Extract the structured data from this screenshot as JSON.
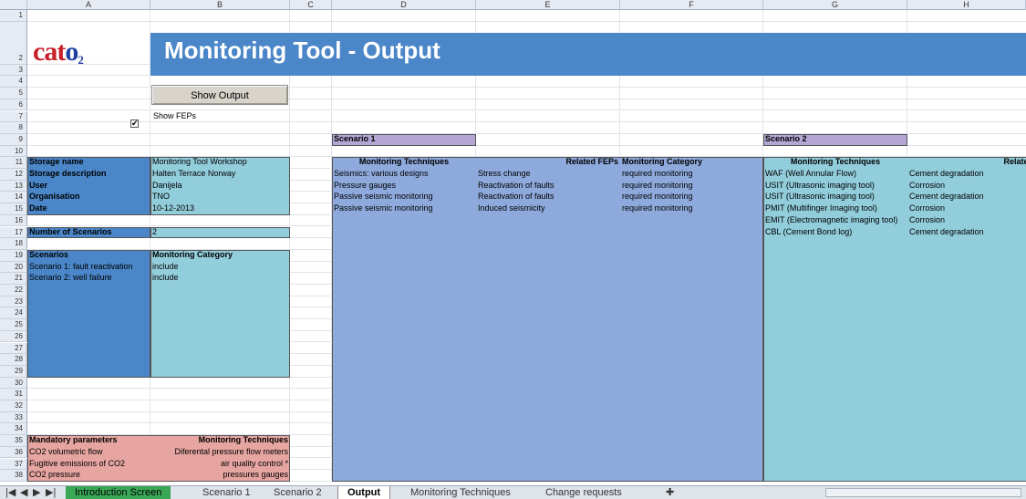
{
  "columns": [
    "A",
    "B",
    "C",
    "D",
    "E",
    "F",
    "G",
    "H"
  ],
  "title": "Monitoring Tool - Output",
  "logo": {
    "main": "cat",
    "accent": "o",
    "sub": "2"
  },
  "show_output_button": "Show Output",
  "show_feps": {
    "label": "Show FEPs",
    "checked": true
  },
  "storage": [
    {
      "label": "Storage name",
      "value": "Monitoring Tool Workshop"
    },
    {
      "label": "Storage description",
      "value": "Halten Terrace Norway"
    },
    {
      "label": "User",
      "value": "Danijela"
    },
    {
      "label": "Organisation",
      "value": "TNO"
    },
    {
      "label": "Date",
      "value": "10-12-2013"
    }
  ],
  "num_scenarios": {
    "label": "Number of Scenarios",
    "value": "2"
  },
  "scenarios_table": {
    "headers": [
      "Scenarios",
      "Monitoring Category"
    ],
    "rows": [
      [
        "Scenario 1: fault reactivation",
        "include"
      ],
      [
        "Scenario 2: well failure",
        "include"
      ]
    ]
  },
  "mandatory": {
    "headers": [
      "Mandatory parameters",
      "Monitoring Techniques"
    ],
    "rows": [
      [
        "CO2 volumetric flow",
        "Diferental pressure flow meters"
      ],
      [
        "Fugitive emissions of CO2",
        "air quality control *"
      ],
      [
        "CO2 pressure",
        "pressures gauges"
      ]
    ]
  },
  "scenario1": {
    "label": "Scenario 1",
    "headers": [
      "Monitoring Techniques",
      "Related FEPs",
      "Monitoring Category"
    ],
    "rows": [
      [
        "Seismics: various designs",
        "Stress change",
        "required monitoring"
      ],
      [
        "Pressure gauges",
        "Reactivation of faults",
        "required monitoring"
      ],
      [
        "Passive seismic monitoring",
        "Reactivation of faults",
        "required monitoring"
      ],
      [
        "Passive seismic monitoring",
        "Induced seismicity",
        "required monitoring"
      ]
    ]
  },
  "scenario2": {
    "label": "Scenario 2",
    "headers": [
      "Monitoring Techniques",
      "Related FEPs"
    ],
    "rows": [
      [
        "WAF (Well Annular Flow)",
        "Cement degradation"
      ],
      [
        "USIT (Ultrasonic imaging tool)",
        "Corrosion"
      ],
      [
        "USIT (Ultrasonic imaging tool)",
        "Cement degradation"
      ],
      [
        "PMIT (Multifinger Imaging tool)",
        "Corrosion"
      ],
      [
        "EMIT (Electromagnetic imaging tool)",
        "Corrosion"
      ],
      [
        "CBL (Cement Bond log)",
        "Cement degradation"
      ]
    ]
  },
  "sheet_tabs": [
    {
      "label": "Introduction Screen",
      "active": false,
      "green": true
    },
    {
      "label": "Scenario 1",
      "active": false
    },
    {
      "label": "Scenario 2",
      "active": false
    },
    {
      "label": "Output",
      "active": true
    },
    {
      "label": "Monitoring Techniques",
      "active": false
    },
    {
      "label": "Change requests",
      "active": false
    }
  ],
  "colors": {
    "title_blue": "#4a86c8",
    "label_blue": "#4a86c8",
    "value_cyan": "#92cddc",
    "scenario_purple": "#b4a7d6",
    "s1_blue": "#8ea9db",
    "s2_cyan": "#92cddc",
    "mandatory_red": "#e6a5a1",
    "tab_green": "#3aa757"
  }
}
